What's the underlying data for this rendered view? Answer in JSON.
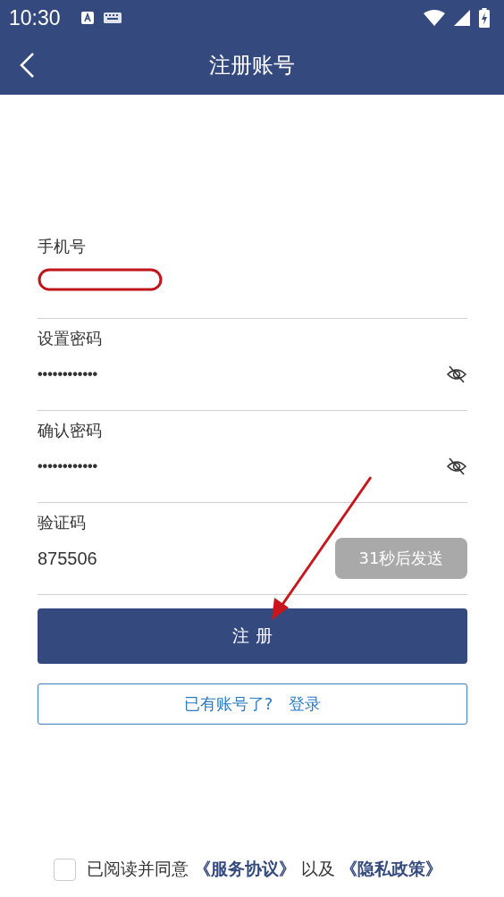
{
  "status_bar": {
    "time": "10:30"
  },
  "header": {
    "title": "注册账号"
  },
  "fields": [
    {
      "kind": "phone",
      "label": "手机号",
      "redacted": true
    },
    {
      "kind": "password",
      "label": "设置密码",
      "value": "••••••••••••",
      "visible": false
    },
    {
      "kind": "password",
      "label": "确认密码",
      "value": "••••••••••••",
      "visible": false
    },
    {
      "kind": "code",
      "label": "验证码",
      "value": "875506",
      "send_button": {
        "label": "31秒后发送",
        "disabled": true
      }
    }
  ],
  "register_button": {
    "label": "注 册"
  },
  "login_link": {
    "prompt": "已有账号了?",
    "action": "登录"
  },
  "agreement": {
    "checked": false,
    "text": "已阅读并同意",
    "links": [
      "《服务协议》",
      "《隐私政策》"
    ],
    "joiner": "以及"
  },
  "annotations": [
    {
      "kind": "arrow"
    }
  ]
}
